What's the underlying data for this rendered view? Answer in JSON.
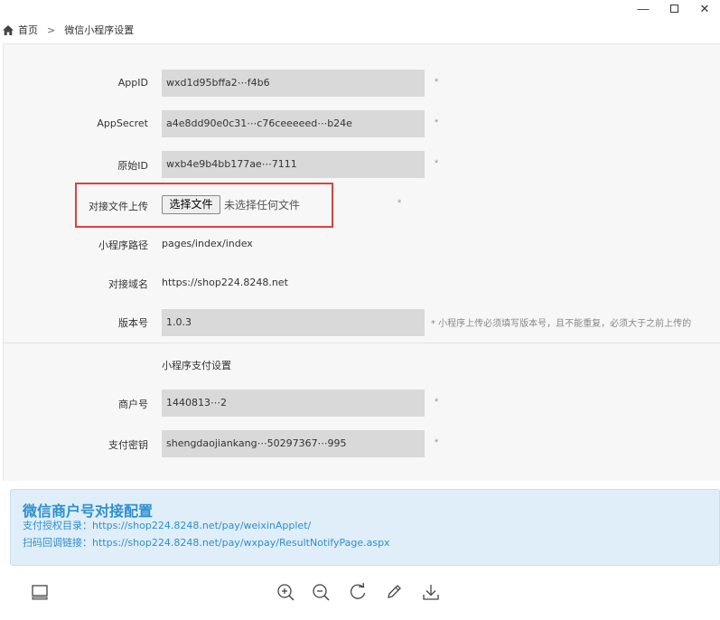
{
  "window": {
    "minimize": "—",
    "close": "✕"
  },
  "breadcrumb": {
    "home": "首页",
    "separator": ">",
    "current": "微信小程序设置"
  },
  "form": {
    "appid": {
      "label": "AppID",
      "value": "wxd1d95bffa2⋯f4b6",
      "required": "*"
    },
    "appsecret": {
      "label": "AppSecret",
      "value": "a4e8dd90e0c31⋯c76ceeeeed⋯b24e",
      "required": "*"
    },
    "original_id": {
      "label": "原始ID",
      "value": "wxb4e9b4bb177ae⋯7111",
      "required": "*"
    },
    "upload": {
      "label": "对接文件上传",
      "button": "选择文件",
      "status": "未选择任何文件",
      "required": "*"
    },
    "path": {
      "label": "小程序路径",
      "value": "pages/index/index"
    },
    "domain": {
      "label": "对接域名",
      "value": "https://shop224.8248.net"
    },
    "version": {
      "label": "版本号",
      "value": "1.0.3",
      "note": "* 小程序上传必须填写版本号，且不能重复，必须大于之前上传的"
    },
    "payment_section": "小程序支付设置",
    "merchant_id": {
      "label": "商户号",
      "value": "1440813⋯2",
      "required": "*"
    },
    "pay_key": {
      "label": "支付密钥",
      "value": "shengdaojiankang⋯50297367⋯995",
      "required": "*"
    }
  },
  "info": {
    "title": "微信商户号对接配置",
    "auth_dir": "支付授权目录：https://shop224.8248.net/pay/weixinApplet/",
    "callback": "扫码回调链接：https://shop224.8248.net/pay/wxpay/ResultNotifyPage.aspx"
  },
  "toolbar": {
    "icons": [
      "layout-icon",
      "zoom-in-icon",
      "zoom-out-icon",
      "rotate-icon",
      "edit-icon",
      "download-icon"
    ]
  },
  "colors": {
    "accent": "#2f8fce",
    "highlight": "#e0403f",
    "input_bg": "#d9d9d9",
    "panel_bg": "#f7f7f7",
    "info_bg": "#dfeef8"
  }
}
